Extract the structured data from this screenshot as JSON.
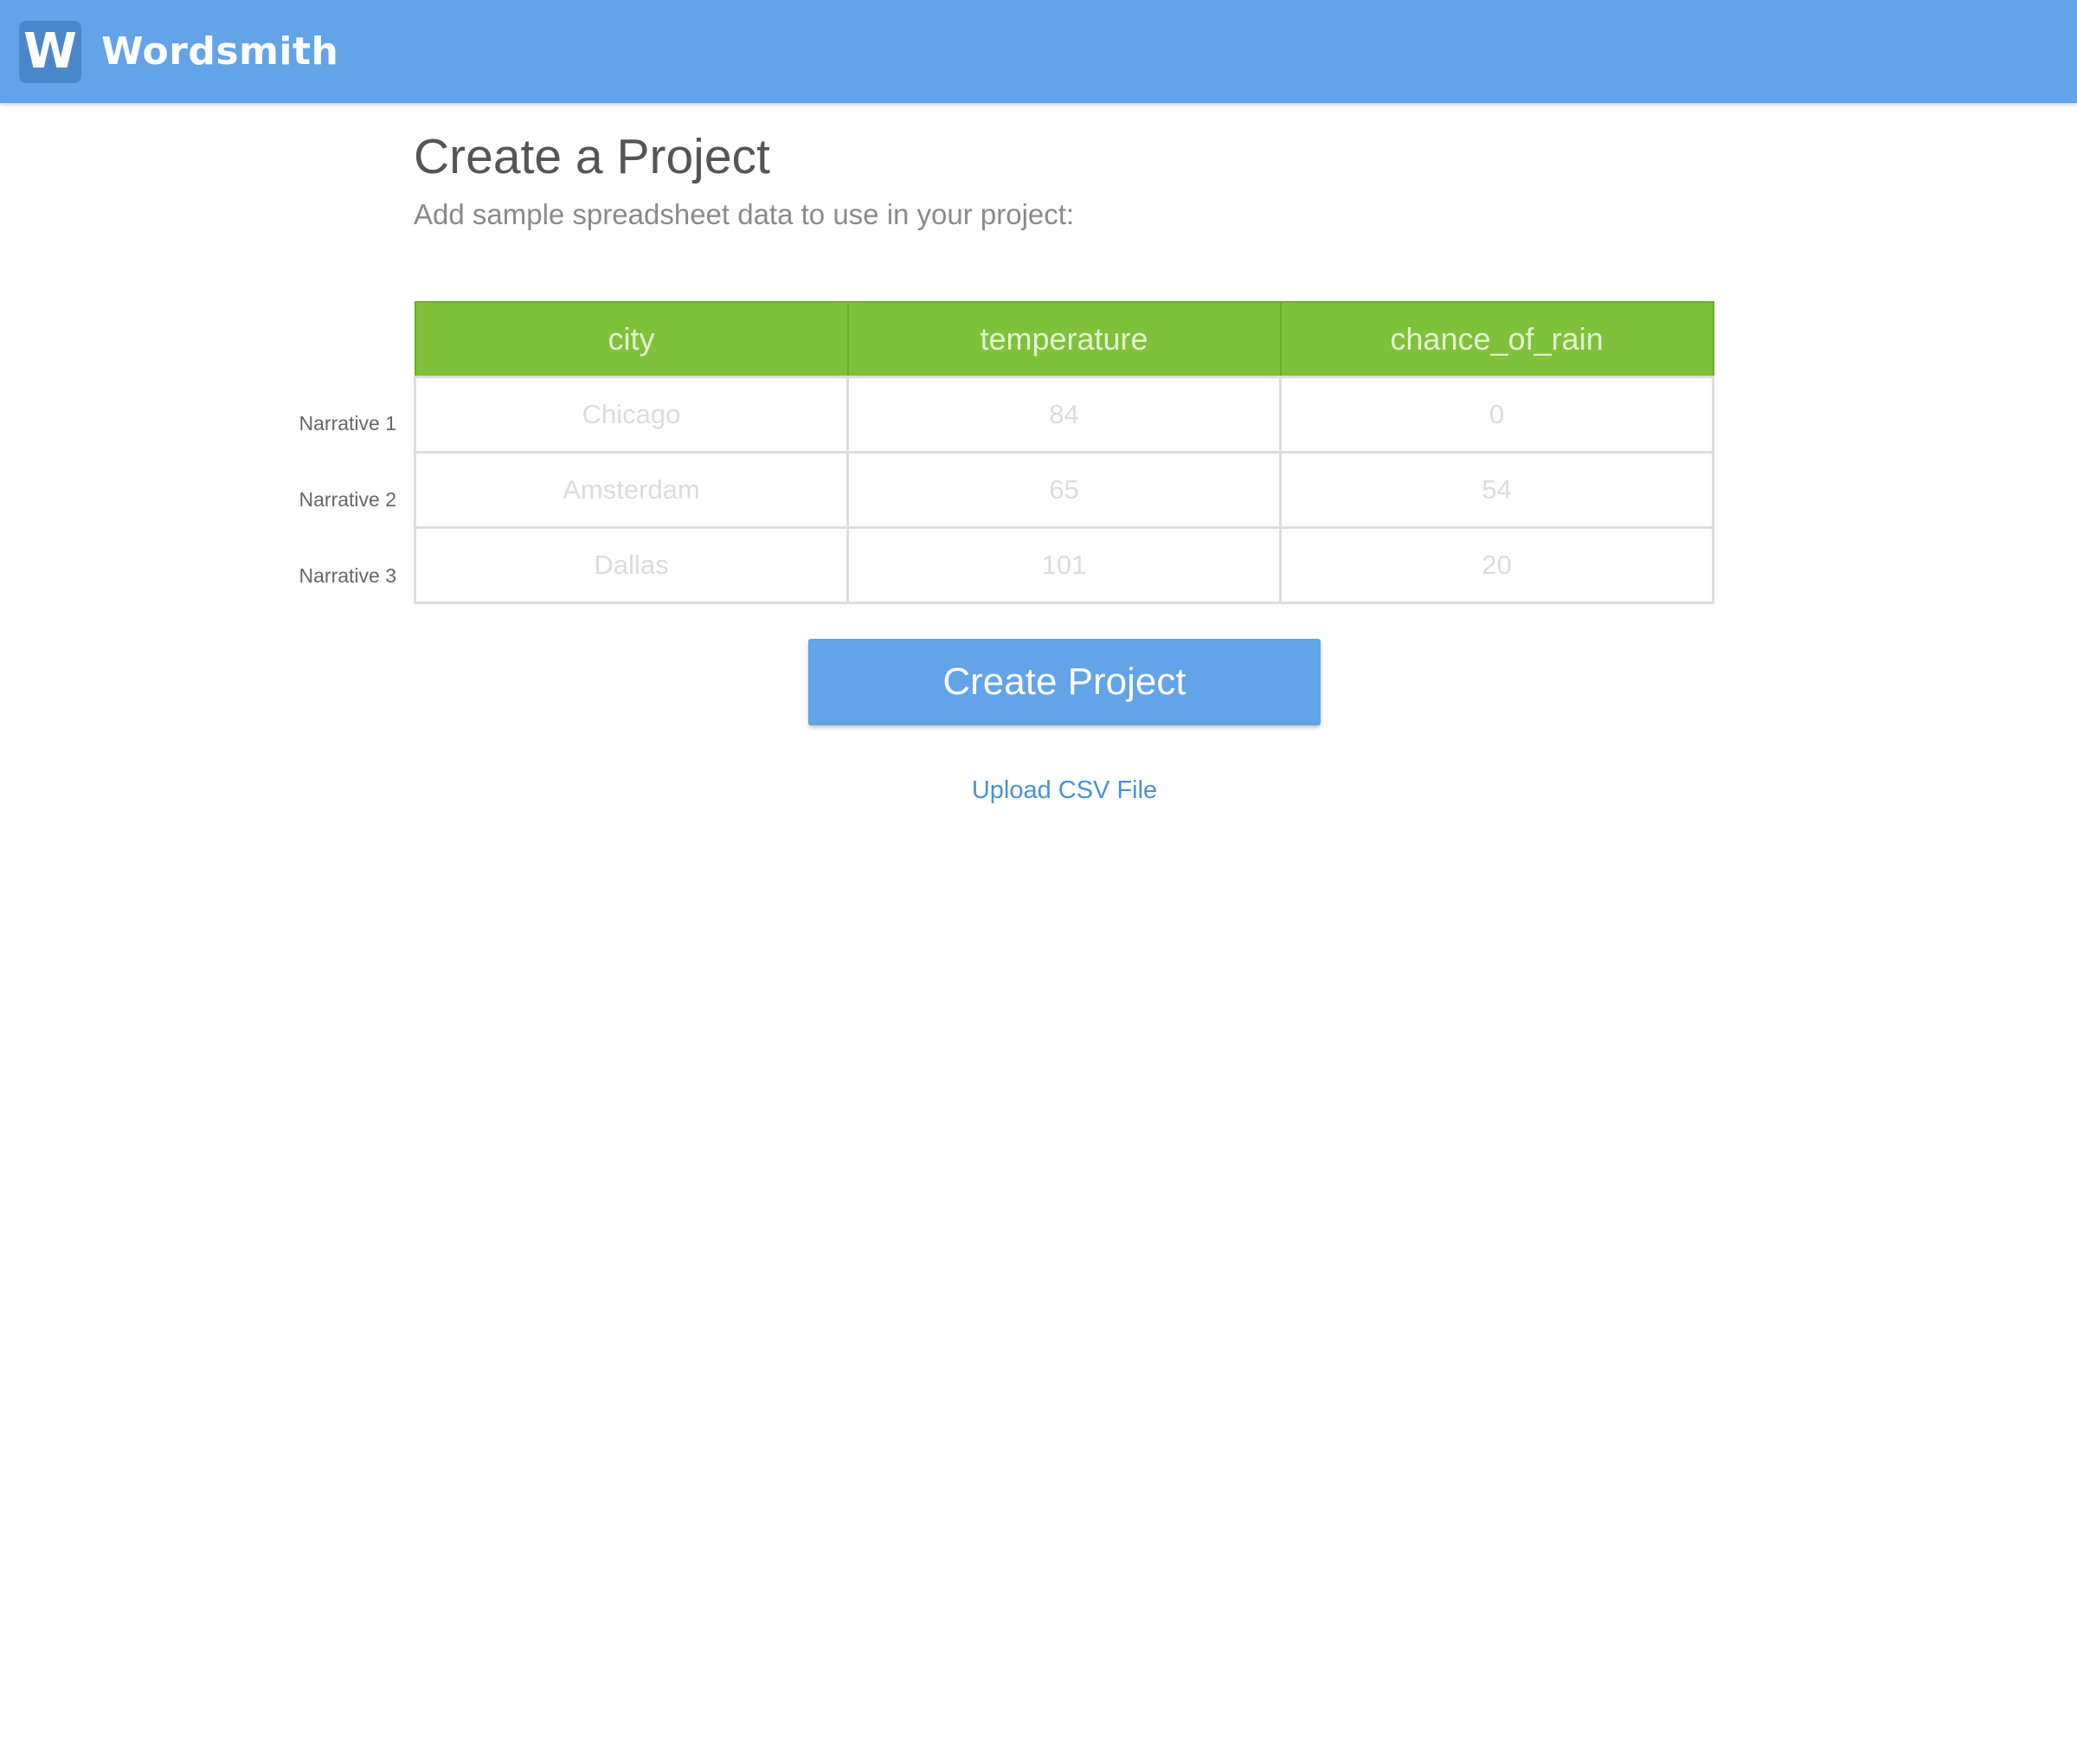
{
  "header": {
    "logo_letter": "W",
    "brand_name": "Wordsmith",
    "color": "#63a3e8"
  },
  "main": {
    "title": "Create a Project",
    "subtitle": "Add sample spreadsheet data to use in your project:"
  },
  "table": {
    "header_color": "#80c13b",
    "columns": [
      "city",
      "temperature",
      "chance_of_rain"
    ],
    "rows": [
      {
        "label": "Narrative 1",
        "cells": [
          "Chicago",
          "84",
          "0"
        ]
      },
      {
        "label": "Narrative 2",
        "cells": [
          "Amsterdam",
          "65",
          "54"
        ]
      },
      {
        "label": "Narrative 3",
        "cells": [
          "Dallas",
          "101",
          "20"
        ]
      }
    ]
  },
  "actions": {
    "create_label": "Create Project",
    "upload_label": "Upload CSV File"
  }
}
